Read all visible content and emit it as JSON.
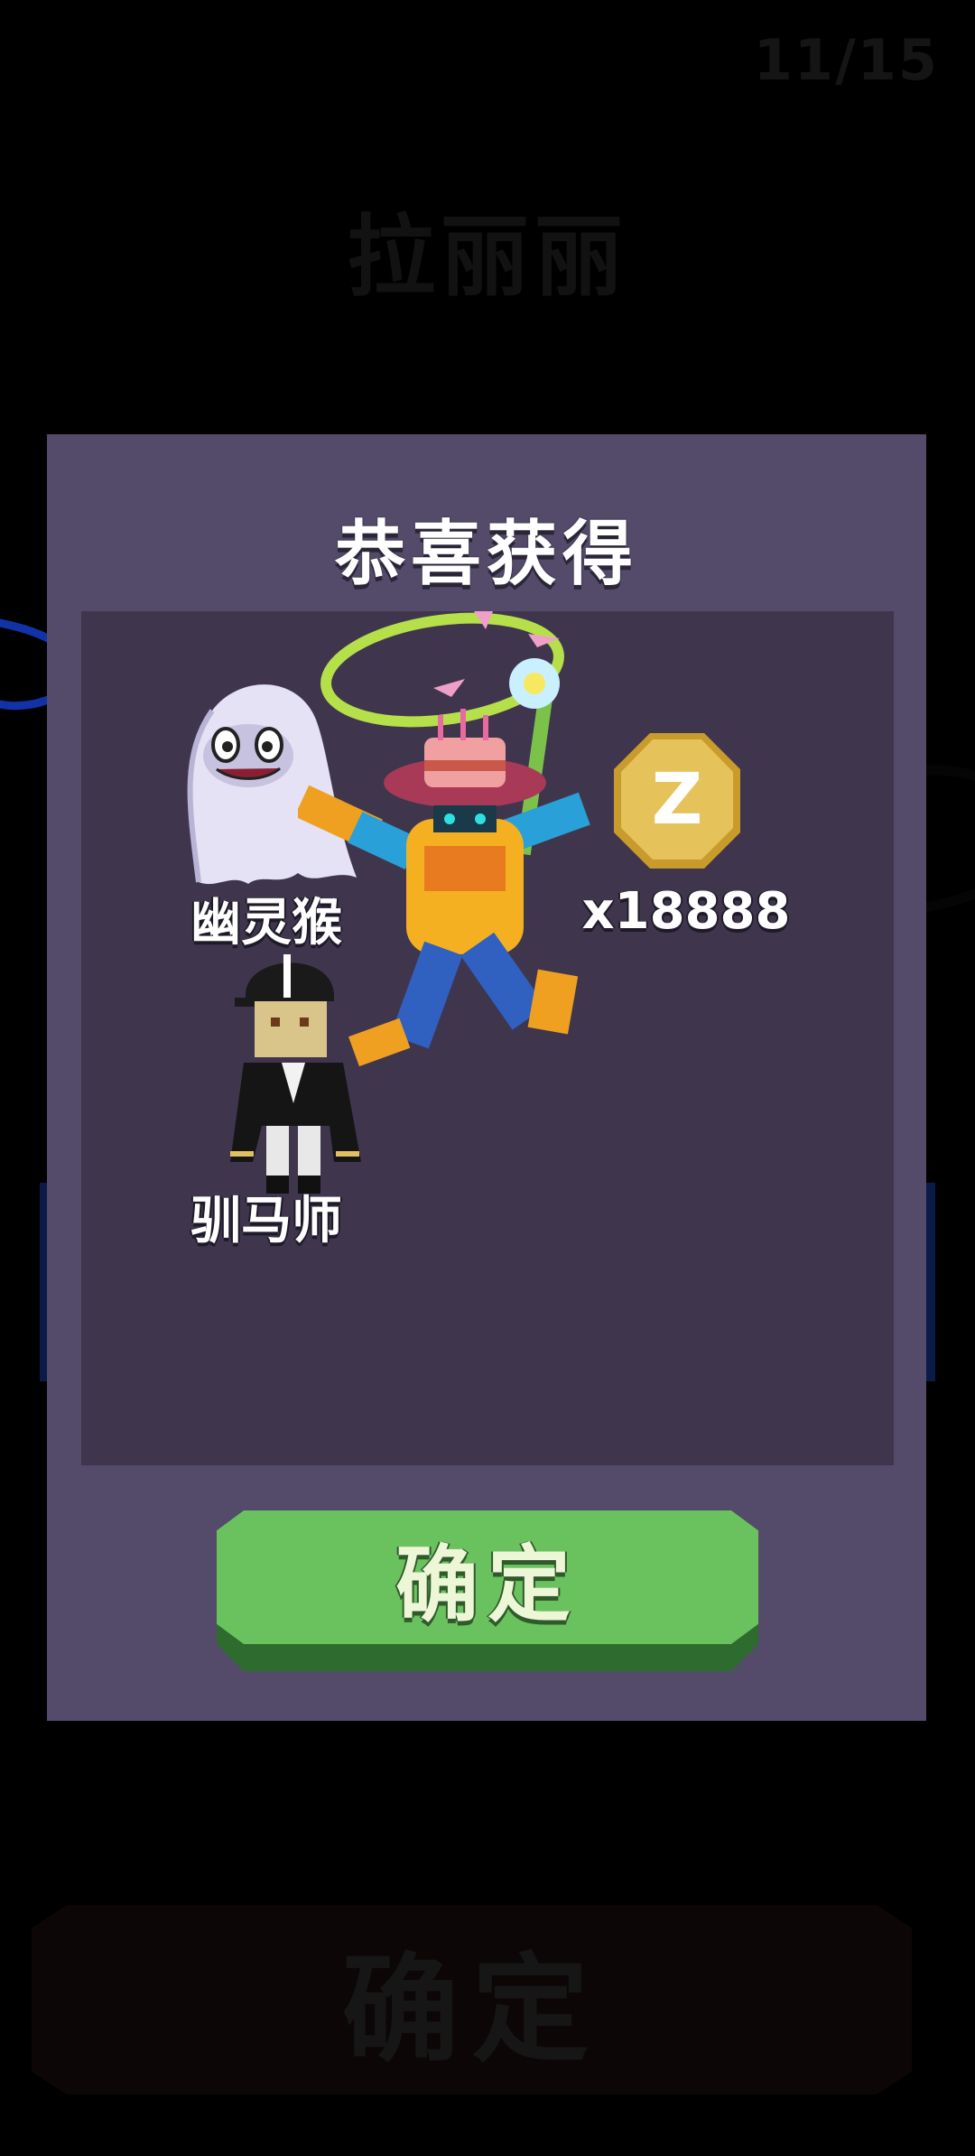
{
  "background": {
    "counter": "11/15",
    "title": "拉丽丽",
    "bottom_button_label": "确定"
  },
  "modal": {
    "title": "恭喜获得",
    "rewards": [
      {
        "label": "幽灵猴",
        "icon": "ghost-monkey-icon"
      },
      {
        "label": "驯马师",
        "icon": "horse-trainer-icon"
      },
      {
        "label": "x18888",
        "icon": "gold-coin-icon"
      },
      {
        "label": "",
        "icon": "cowboy-robot-character-icon"
      }
    ],
    "confirm_label": "确定"
  },
  "colors": {
    "modal_bg": "#534b69",
    "panel_bg": "#3f364e",
    "confirm_green": "#6ac25f"
  }
}
